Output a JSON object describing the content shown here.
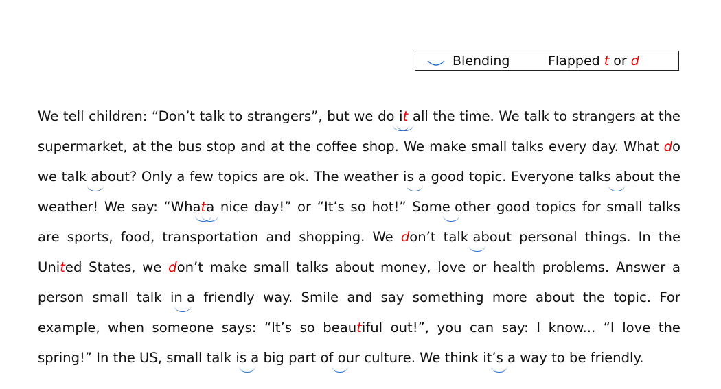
{
  "legend": {
    "blending_label": "Blending",
    "flapped_prefix": "Flapped",
    "flapped_t": "t",
    "flapped_or": "or",
    "flapped_d": "d"
  },
  "colors": {
    "flap_red": "#e00000",
    "blend_arc_blue": "#2b6dc5",
    "text": "#111111"
  },
  "passage": {
    "segments": [
      {
        "text": "We tell children: “Don’t talk to strangers”, but we do "
      },
      {
        "text": "i",
        "blend": true
      },
      {
        "text": "t",
        "flap": true,
        "blend": true
      },
      {
        "text": " all the time. We talk to strangers at the supermarket, at the bus stop and at the coffee shop. We make small talks every day. What "
      },
      {
        "text": "d",
        "flap": true
      },
      {
        "text": "o we "
      },
      {
        "text": "talk about",
        "blend": true
      },
      {
        "text": "? Only a few topics are ok. The weather "
      },
      {
        "text": "is a",
        "blend": true
      },
      {
        "text": " good topic. Everyone "
      },
      {
        "text": "talks about",
        "blend": true
      },
      {
        "text": " the weather! We say: “Wha"
      },
      {
        "text": "t",
        "flap": true,
        "blend": true
      },
      {
        "text": " a",
        "blend": true
      },
      {
        "text": " nice day!” or “It’s so hot!” "
      },
      {
        "text": "Some other",
        "blend": true
      },
      {
        "text": " good topics for small talks are sports, food, transportation and shopping. We "
      },
      {
        "text": "d",
        "flap": true
      },
      {
        "text": "on’t "
      },
      {
        "text": "talk about",
        "blend": true
      },
      {
        "text": " personal things. In the Uni"
      },
      {
        "text": "t",
        "flap": true
      },
      {
        "text": "ed States, we "
      },
      {
        "text": "d",
        "flap": true
      },
      {
        "text": "on’t make small talks about money, love or health problems. Answer a person small talk "
      },
      {
        "text": "in a",
        "blend": true
      },
      {
        "text": " friendly way. Smile and say something more about the topic. For example, when someone says: “It’s so beau"
      },
      {
        "text": "t",
        "flap": true
      },
      {
        "text": "iful out!”, you can say: I know... “I love the spring!” In the US, small talk "
      },
      {
        "text": "is a",
        "blend": true
      },
      {
        "text": " big part "
      },
      {
        "text": "of our",
        "blend": true
      },
      {
        "text": " culture. We think "
      },
      {
        "text": "it’s a",
        "blend": true
      },
      {
        "text": " way to be friendly."
      }
    ]
  }
}
